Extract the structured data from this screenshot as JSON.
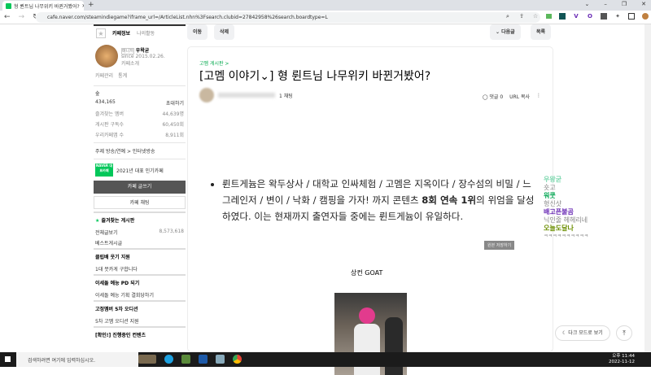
{
  "browser": {
    "tab_title": "형 륀트님 나무위키 바뀐거봤어?",
    "url": "cafe.naver.com/steamindiegame?iframe_url=/ArticleList.nhn%3Fsearch.clubid=27842958%26search.boardtype=L",
    "window_controls": [
      "⌄",
      "–",
      "❐",
      "✕"
    ]
  },
  "sidebar": {
    "tab_info": "카페정보",
    "tab_activity": "나의활동",
    "manager_badge": "매니저",
    "manager_name": "우왁굳",
    "since": "since 2015.02.26.",
    "cafe_intro": "카페소개",
    "cafe_manage": "카페관리",
    "stats": "통계",
    "level": "숲",
    "members": "434,165",
    "invite": "초대하기",
    "fav_members_label": "즐겨찾는 멤버",
    "fav_members": "44,639명",
    "board_sub_label": "게시판 구독수",
    "board_sub": "60,450회",
    "cafe_apps_label": "우리카페앱 수",
    "cafe_apps": "8,911회",
    "topic": "주제 방송/연예 > 인터넷방송",
    "naver_badge": "NAVER 대표카페",
    "award": "2021년 대표 인기카페",
    "write_btn": "카페 글쓰기",
    "chat_btn": "카페 채팅",
    "fav_boards": "즐겨찾는 게시판",
    "boards": [
      {
        "name": "전체글보기",
        "count": "8,573,618"
      },
      {
        "name": "베스트게시글",
        "count": ""
      }
    ],
    "sections": [
      {
        "title": "클립배 웃기 지원",
        "item": "1대 뭇카게 구합니다"
      },
      {
        "title": "이세돌 예능 PD 되기",
        "item": "이세돌 예능 기획 결회당하기"
      },
      {
        "title": "고정멤버 5차 오디션",
        "item": "5차 고멤 오디션 지원"
      }
    ],
    "last_section": "[확인!] 진행중인 컨텐츠"
  },
  "toolbar": {
    "move": "이동",
    "delete": "삭제",
    "next": "다음글",
    "list": "목록"
  },
  "article": {
    "category": "고멤 게시판 >",
    "title": "[고멤 이야기⌄] 형 륀트님 나무위키 바뀐거봤어?",
    "author_level": "1 채팅",
    "comments": "댓글 0",
    "url_copy": "URL 복사",
    "body_pre": "륀트게늄은 왁두상사 / 대학교 인싸체험 / 고멤은 지옥이다 / 장수섬의 비밀 / 느그레인저 / 변이 / 낙화 / 캠핑을 가자! 까지 콘텐츠 ",
    "body_bold": "8회 연속 1위",
    "body_post": "의 위엄을 달성하였다. 이는 현재까지 출연자들 중에는 륀트게늄이 유일하다.",
    "save_original": "원본 저장하기",
    "caption": "상컨 GOAT"
  },
  "chat": [
    {
      "name": "우왕굳",
      "msg": "숏고",
      "color": "#7fd8b0"
    },
    {
      "name": "워쿳",
      "msg": "형신샷",
      "color": "#00a651"
    },
    {
      "name": "배고픈불곰",
      "msg": "닉인줄 헤헤리네",
      "color": "#6a2bb5"
    },
    {
      "name": "오늘도달나",
      "msg": "ㅋㅋㅋㅋㅋㅋㅋㅋㅋㅋ",
      "color": "#6b8e00"
    }
  ],
  "dark_mode": "다크 모드로 보기",
  "taskbar": {
    "search": "검색하려면 여기에 입력하십시오.",
    "time": "오후 11:44",
    "date": "2022-11-12"
  }
}
